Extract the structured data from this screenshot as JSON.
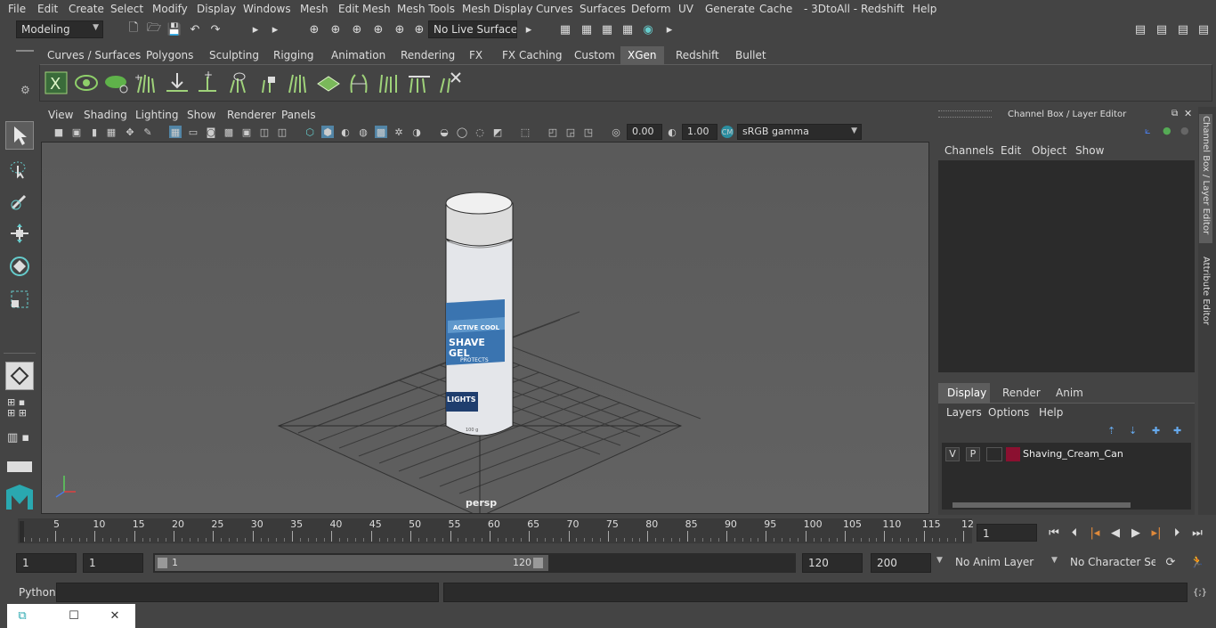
{
  "menus": [
    "File",
    "Edit",
    "Create",
    "Select",
    "Modify",
    "Display",
    "Windows",
    "Mesh",
    "Edit Mesh",
    "Mesh Tools",
    "Mesh Display",
    "Curves",
    "Surfaces",
    "Deform",
    "UV",
    "Generate",
    "Cache",
    "- 3DtoAll -",
    "Redshift",
    "Help"
  ],
  "status": {
    "mode": "Modeling",
    "live_surface": "No Live Surface"
  },
  "shelf_tabs": [
    "Curves / Surfaces",
    "Polygons",
    "Sculpting",
    "Rigging",
    "Animation",
    "Rendering",
    "FX",
    "FX Caching",
    "Custom",
    "XGen",
    "Redshift",
    "Bullet"
  ],
  "active_shelf": "XGen",
  "viewport": {
    "menus": [
      "View",
      "Shading",
      "Lighting",
      "Show",
      "Renderer",
      "Panels"
    ],
    "exposure": "0.00",
    "gamma": "1.00",
    "color_space": "sRGB gamma",
    "camera": "persp",
    "label": {
      "brand": "SHAVE",
      "line1": "ACTIVE COOL",
      "line2": "GEL",
      "line3": "PROTECTS",
      "line4": "LIGHTS",
      "small": "100 g"
    }
  },
  "channel_box": {
    "title": "Channel Box / Layer Editor",
    "menus": [
      "Channels",
      "Edit",
      "Object",
      "Show"
    ],
    "layer_tabs": [
      "Display",
      "Render",
      "Anim"
    ],
    "active_layer_tab": "Display",
    "layer_menus": [
      "Layers",
      "Options",
      "Help"
    ],
    "layer": {
      "v": "V",
      "p": "P",
      "name": "Shaving_Cream_Can",
      "color": "#8b1030"
    }
  },
  "side_tabs": [
    "Channel Box / Layer Editor",
    "Attribute Editor"
  ],
  "timeline": {
    "ticks": [
      "5",
      "10",
      "15",
      "20",
      "25",
      "30",
      "35",
      "40",
      "45",
      "50",
      "55",
      "60",
      "65",
      "70",
      "75",
      "80",
      "85",
      "90",
      "95",
      "100",
      "105",
      "110",
      "115",
      "12"
    ],
    "start_label": "1",
    "current_frame": "1"
  },
  "range": {
    "start": "1",
    "start2": "1",
    "slider_start": "1",
    "slider_end": "120",
    "end": "120",
    "max": "200",
    "anim_layer": "No Anim Layer",
    "char_set": "No Character Set"
  },
  "command": {
    "lang": "Python"
  },
  "colors": {
    "accent": "#5285a6",
    "bg": "#444444",
    "field": "#2b2b2b"
  }
}
